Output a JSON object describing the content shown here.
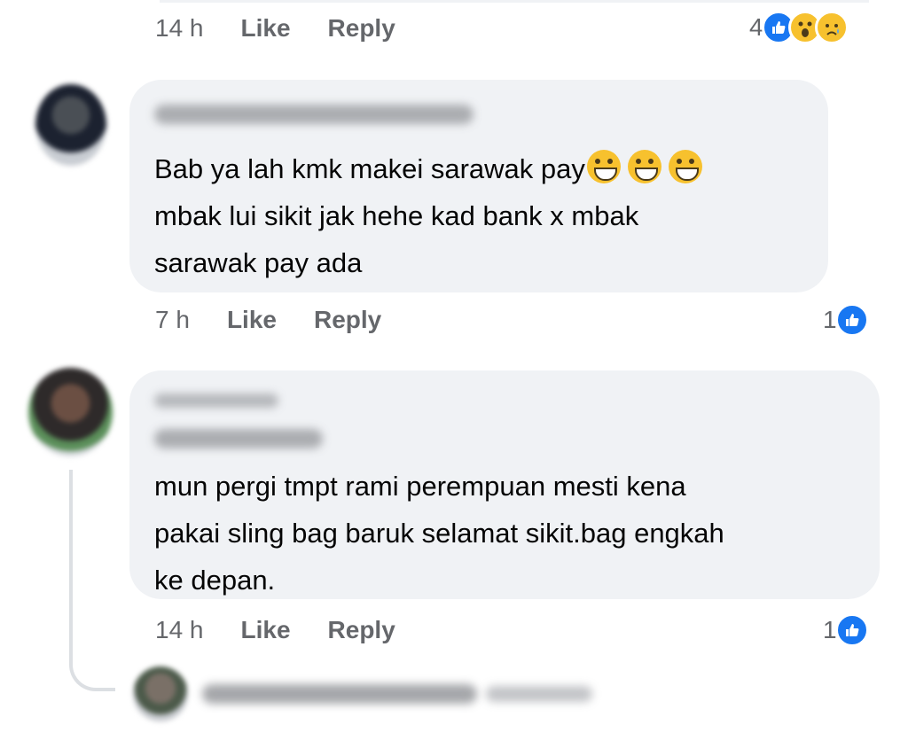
{
  "comments": [
    {
      "meta": {
        "time": "14 h",
        "like": "Like",
        "reply": "Reply"
      },
      "reactions": {
        "count": "4",
        "icons": [
          "like-icon",
          "wow-icon",
          "sad-icon"
        ]
      }
    },
    {
      "body_lines": [
        "Bab ya lah kmk makei sarawak pay",
        "mbak lui sikit jak hehe kad bank x mbak",
        "sarawak pay ada"
      ],
      "emojis": [
        "grinning-sweat-emoji",
        "grinning-sweat-emoji",
        "grinning-sweat-emoji"
      ],
      "meta": {
        "time": "7 h",
        "like": "Like",
        "reply": "Reply"
      },
      "reactions": {
        "count": "1",
        "icons": [
          "like-icon"
        ]
      }
    },
    {
      "body_lines": [
        "mun pergi tmpt rami perempuan mesti kena",
        "pakai sling bag baruk selamat sikit.bag engkah",
        "ke depan."
      ],
      "meta": {
        "time": "14 h",
        "like": "Like",
        "reply": "Reply"
      },
      "reactions": {
        "count": "1",
        "icons": [
          "like-icon"
        ]
      }
    }
  ],
  "colors": {
    "bubble": "#f0f2f5",
    "meta_text": "#65676b",
    "like_blue": "#1877f2",
    "emoji_yellow": "#f7c12e"
  }
}
